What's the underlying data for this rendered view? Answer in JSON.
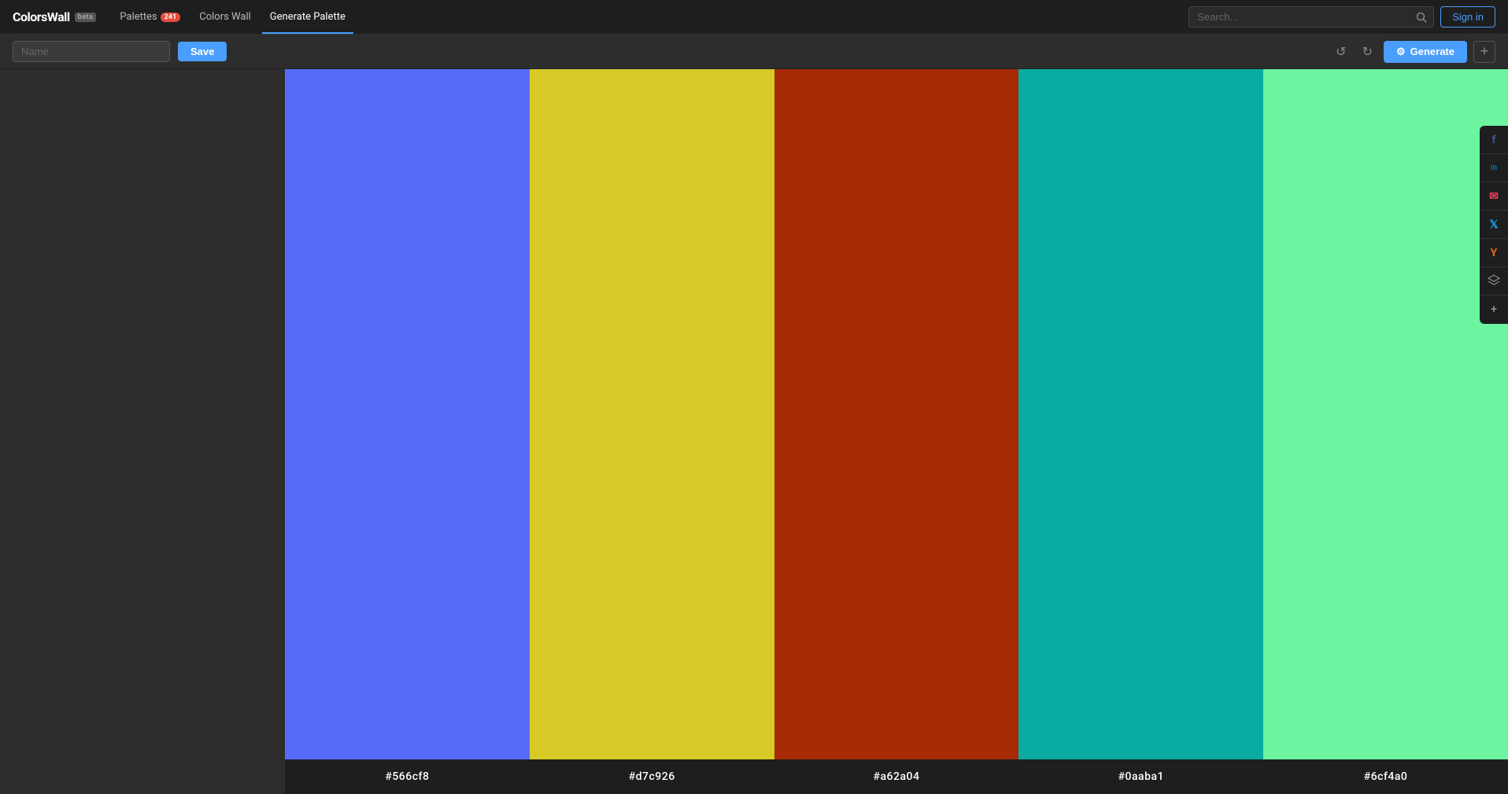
{
  "header": {
    "logo": "ColorsWall",
    "beta": "beta",
    "nav": [
      {
        "id": "palettes",
        "label": "Palettes",
        "badge": "241",
        "active": false
      },
      {
        "id": "colors-wall",
        "label": "Colors Wall",
        "active": false
      },
      {
        "id": "generate-palette",
        "label": "Generate Palette",
        "active": true
      }
    ],
    "search_placeholder": "Search...",
    "sign_in": "Sign in"
  },
  "toolbar": {
    "name_placeholder": "Name",
    "save_label": "Save",
    "generate_label": "Generate",
    "undo_icon": "↺",
    "redo_icon": "↻",
    "generate_icon": "⚙",
    "add_icon": "+"
  },
  "palette": {
    "colors": [
      {
        "id": "color-1",
        "hex": "#566cf8",
        "label": "#566cf8"
      },
      {
        "id": "color-2",
        "hex": "#d7c926",
        "label": "#d7c926"
      },
      {
        "id": "color-3",
        "hex": "#a62a04",
        "label": "#a62a04"
      },
      {
        "id": "color-4",
        "hex": "#0aaba1",
        "label": "#0aaba1"
      },
      {
        "id": "color-5",
        "hex": "#6cf4a0",
        "label": "#6cf4a0"
      }
    ]
  },
  "social": {
    "items": [
      {
        "id": "facebook",
        "symbol": "f",
        "label": "Facebook"
      },
      {
        "id": "linkedin",
        "symbol": "in",
        "label": "LinkedIn"
      },
      {
        "id": "pocket",
        "symbol": "✉",
        "label": "Pocket"
      },
      {
        "id": "twitter",
        "symbol": "t",
        "label": "Twitter"
      },
      {
        "id": "yc",
        "symbol": "Y",
        "label": "YCombinator"
      },
      {
        "id": "layers",
        "symbol": "≡",
        "label": "Layers"
      },
      {
        "id": "plus",
        "symbol": "+",
        "label": "More"
      }
    ]
  }
}
